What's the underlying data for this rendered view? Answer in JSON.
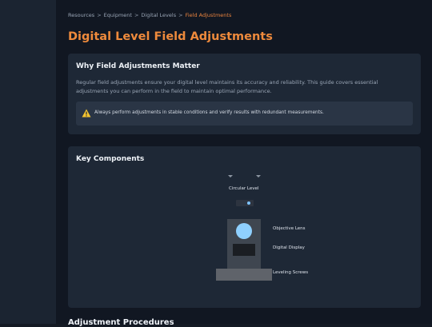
{
  "breadcrumb": {
    "items": [
      "Resources",
      "Equipment",
      "Digital Levels"
    ],
    "current": "Field Adjustments",
    "separator": ">"
  },
  "page": {
    "title": "Digital Level Field Adjustments"
  },
  "why_card": {
    "title": "Why Field Adjustments Matter",
    "body": "Regular field adjustments ensure your digital level maintains its accuracy and reliability. This guide covers essential adjustments you can perform in the field to maintain optimal performance.",
    "warning_icon": "warning-triangle-icon",
    "warning": "Always perform adjustments in stable conditions and verify results with redundant measurements."
  },
  "components_card": {
    "title": "Key Components",
    "labels": {
      "circular_level": "Circular Level",
      "objective_lens": "Objective Lens",
      "digital_display": "Digital Display",
      "leveling_screws": "Leveling Screws"
    }
  },
  "next_section": {
    "title": "Adjustment Procedures"
  },
  "colors": {
    "accent": "#ee8a3c",
    "background": "#111722",
    "card": "#1e2836",
    "warning_icon": "#f4c430",
    "lens": "#8fd0ff"
  }
}
